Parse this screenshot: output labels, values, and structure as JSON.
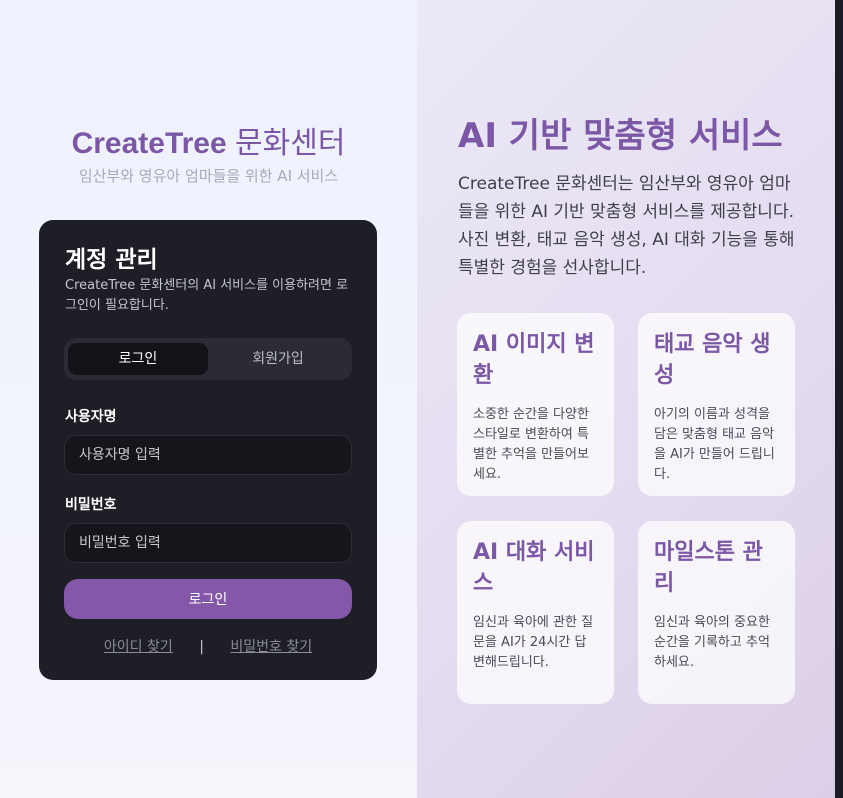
{
  "brand": {
    "name": "CreateTree",
    "suffix": "문화센터"
  },
  "tagline": "임산부와 영유아 엄마들을 위한 AI 서비스",
  "login_card": {
    "title": "계정 관리",
    "description": "CreateTree 문화센터의 AI 서비스를 이용하려면 로그인이 필요합니다.",
    "tabs": [
      {
        "label": "로그인",
        "active": true
      },
      {
        "label": "회원가입",
        "active": false
      }
    ],
    "username": {
      "label": "사용자명",
      "placeholder": "사용자명 입력",
      "value": ""
    },
    "password": {
      "label": "비밀번호",
      "placeholder": "비밀번호 입력",
      "value": ""
    },
    "submit_label": "로그인",
    "find_id_label": "아이디 찾기",
    "separator": "|",
    "find_password_label": "비밀번호 찾기"
  },
  "hero": {
    "title": "AI 기반 맞춤형 서비스",
    "description": "CreateTree 문화센터는 임산부와 영유아 엄마들을 위한 AI 기반 맞춤형 서비스를 제공합니다. 사진 변환, 태교 음악 생성, AI 대화 기능을 통해 특별한 경험을 선사합니다."
  },
  "features": [
    {
      "title": "AI 이미지 변환",
      "description": "소중한 순간을 다양한 스타일로 변환하여 특별한 추억을 만들어보세요."
    },
    {
      "title": "태교 음악 생성",
      "description": "아기의 이름과 성격을 담은 맞춤형 태교 음악을 AI가 만들어 드립니다."
    },
    {
      "title": "AI 대화 서비스",
      "description": "임신과 육아에 관한 질문을 AI가 24시간 답변해드립니다."
    },
    {
      "title": "마일스톤 관리",
      "description": "임신과 육아의 중요한 순간을 기록하고 추억하세요."
    }
  ],
  "colors": {
    "accent": "#7b57a6",
    "button": "#8457a8",
    "card_background": "#1e1f26"
  }
}
